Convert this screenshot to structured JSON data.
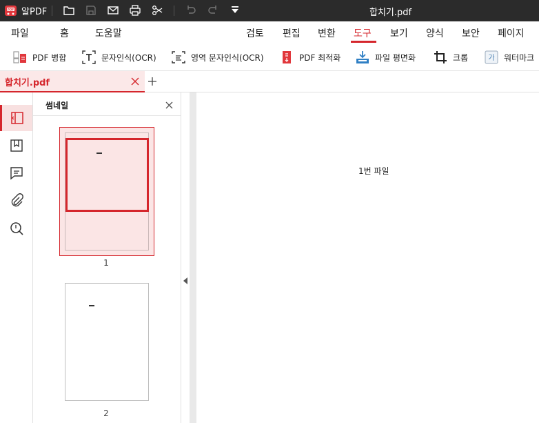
{
  "app": {
    "name": "알PDF",
    "document_title": "합치기.pdf"
  },
  "menu": {
    "left": [
      "파일",
      "홈",
      "도움말"
    ],
    "right": [
      "검토",
      "편집",
      "변환",
      "도구",
      "보기",
      "양식",
      "보안",
      "페이지"
    ],
    "active": "도구"
  },
  "toolbar": {
    "tools": [
      {
        "label": "PDF 병합",
        "icon": "merge-pdf-icon"
      },
      {
        "label": "문자인식(OCR)",
        "icon": "ocr-text-icon"
      },
      {
        "label": "영역 문자인식(OCR)",
        "icon": "area-ocr-icon"
      },
      {
        "label": "PDF 최적화",
        "icon": "optimize-pdf-icon"
      },
      {
        "label": "파일 평면화",
        "icon": "flatten-file-icon"
      },
      {
        "label": "크롭",
        "icon": "crop-icon"
      },
      {
        "label": "워터마크",
        "icon": "watermark-icon"
      }
    ]
  },
  "tabs": {
    "active_label": "합치기.pdf"
  },
  "rail": {
    "icons": [
      "thumbnail-panel-icon",
      "bookmark-icon",
      "comment-icon",
      "attachment-icon",
      "search-icon"
    ]
  },
  "thumbnails": {
    "title": "썸네일",
    "pages": [
      {
        "number": "1",
        "selected": true
      },
      {
        "number": "2",
        "selected": false
      }
    ]
  },
  "document": {
    "page_text": "1번 파일"
  },
  "colors": {
    "accent": "#d5262c",
    "titlebar": "#2b2b2b",
    "selection_fill": "#fbe5e5"
  }
}
